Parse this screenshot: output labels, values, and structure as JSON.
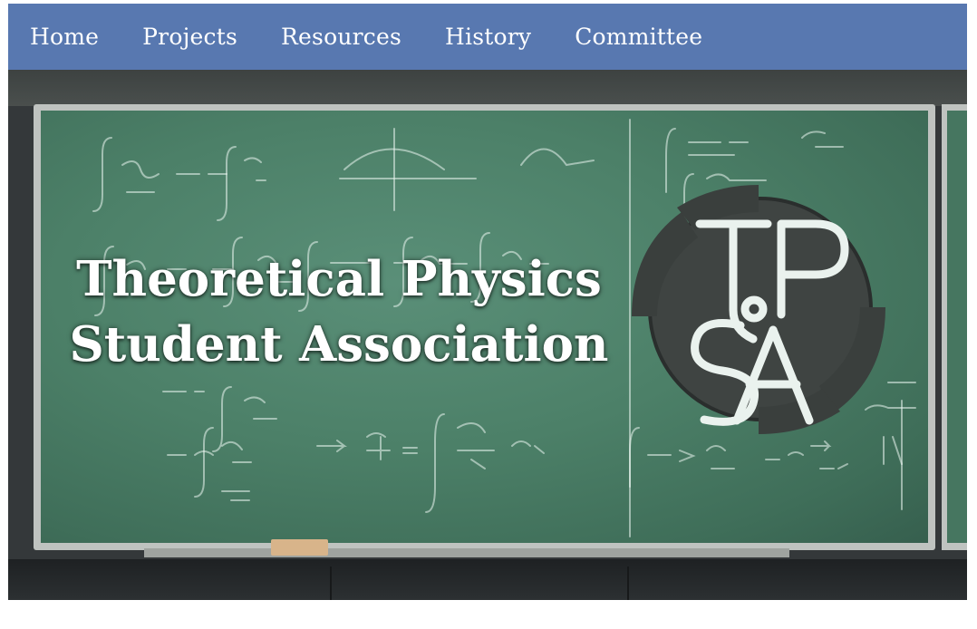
{
  "nav": {
    "items": [
      {
        "label": "Home"
      },
      {
        "label": "Projects"
      },
      {
        "label": "Resources"
      },
      {
        "label": "History"
      },
      {
        "label": "Committee"
      }
    ]
  },
  "hero": {
    "title_line1": "Theoretical Physics",
    "title_line2": "Student Association",
    "logo": {
      "line1": "TP",
      "line2": "SA"
    }
  },
  "colors": {
    "navbar": "#5878b0",
    "chalkboard": "#4c8068"
  }
}
